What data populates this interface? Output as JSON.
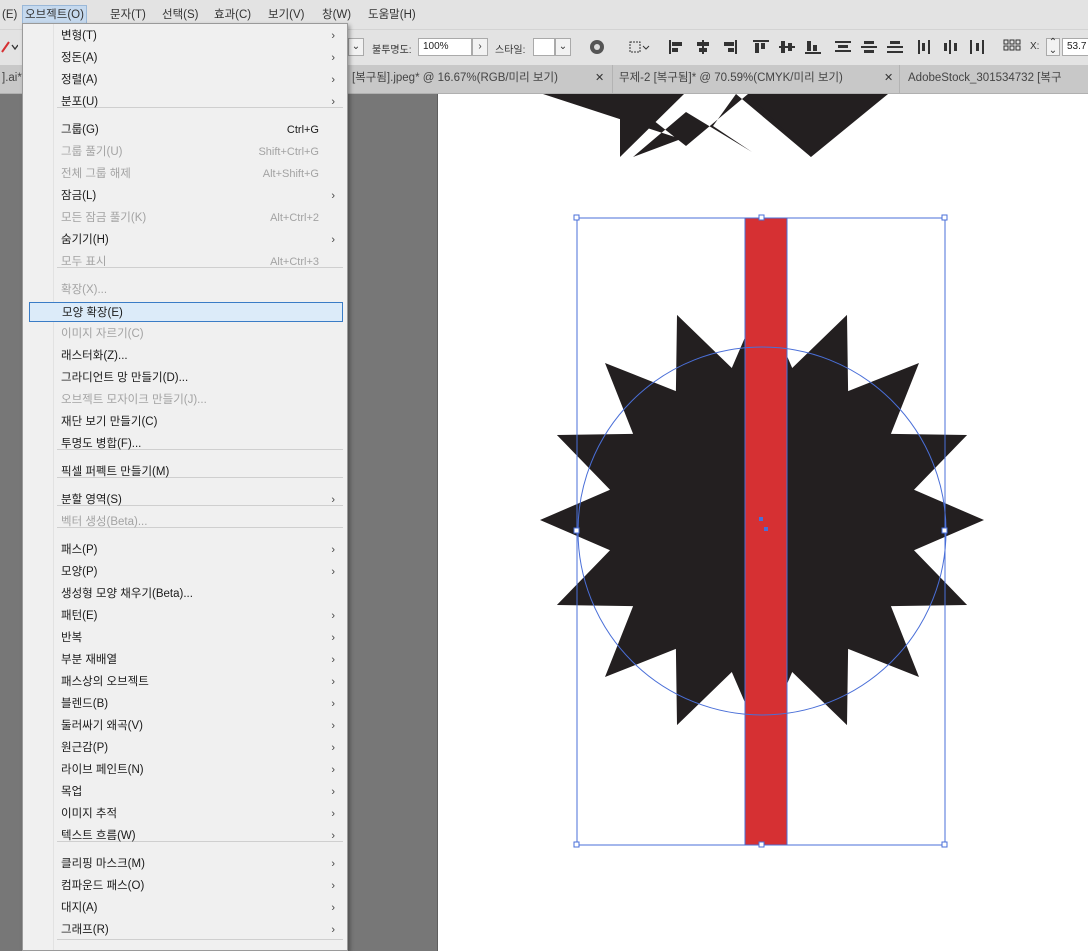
{
  "menubar": {
    "items": [
      "(E)",
      "오브젝트(O)",
      "문자(T)",
      "선택(S)",
      "효과(C)",
      "보기(V)",
      "창(W)",
      "도움말(H)"
    ]
  },
  "controlbar": {
    "opacity_label": "불투명도:",
    "opacity_value": "100%",
    "style_label": "스타일:",
    "x_label": "X:",
    "x_value": "53.7"
  },
  "tabs": [
    {
      "label": "].ai*"
    },
    {
      "label": "[복구됨].jpeg* @ 16.67%(RGB/미리 보기)"
    },
    {
      "label": "무제-2 [복구됨]* @ 70.59%(CMYK/미리 보기)"
    },
    {
      "label": "AdobeStock_301534732 [복구"
    }
  ],
  "object_menu": {
    "items": [
      {
        "label": "변형(T)",
        "submenu": true
      },
      {
        "label": "정돈(A)",
        "submenu": true
      },
      {
        "label": "정렬(A)",
        "submenu": true
      },
      {
        "label": "분포(U)",
        "submenu": true
      },
      {
        "label": "그룹(G)",
        "shortcut": "Ctrl+G"
      },
      {
        "label": "그룹 풀기(U)",
        "shortcut": "Shift+Ctrl+G",
        "disabled": true
      },
      {
        "label": "전체 그룹 해제",
        "shortcut": "Alt+Shift+G",
        "disabled": true
      },
      {
        "label": "잠금(L)",
        "submenu": true
      },
      {
        "label": "모든 잠금 풀기(K)",
        "shortcut": "Alt+Ctrl+2",
        "disabled": true
      },
      {
        "label": "숨기기(H)",
        "submenu": true
      },
      {
        "label": "모두 표시",
        "shortcut": "Alt+Ctrl+3",
        "disabled": true
      },
      {
        "label": "확장(X)...",
        "disabled": true
      },
      {
        "label": "모양 확장(E)",
        "highlighted": true
      },
      {
        "label": "이미지 자르기(C)",
        "disabled": true
      },
      {
        "label": "래스터화(Z)..."
      },
      {
        "label": "그라디언트 망 만들기(D)..."
      },
      {
        "label": "오브젝트 모자이크 만들기(J)...",
        "disabled": true
      },
      {
        "label": "재단 보기 만들기(C)"
      },
      {
        "label": "투명도 병합(F)..."
      },
      {
        "label": "픽셀 퍼펙트 만들기(M)"
      },
      {
        "label": "분할 영역(S)",
        "submenu": true
      },
      {
        "label": "벡터 생성(Beta)...",
        "disabled": true
      },
      {
        "label": "패스(P)",
        "submenu": true
      },
      {
        "label": "모양(P)",
        "submenu": true
      },
      {
        "label": "생성형 모양 채우기(Beta)..."
      },
      {
        "label": "패턴(E)",
        "submenu": true
      },
      {
        "label": "반복",
        "submenu": true
      },
      {
        "label": "부분 재배열",
        "submenu": true
      },
      {
        "label": "패스상의 오브젝트",
        "submenu": true
      },
      {
        "label": "블렌드(B)",
        "submenu": true
      },
      {
        "label": "둘러싸기 왜곡(V)",
        "submenu": true
      },
      {
        "label": "원근감(P)",
        "submenu": true
      },
      {
        "label": "라이브 페인트(N)",
        "submenu": true
      },
      {
        "label": "목업",
        "submenu": true
      },
      {
        "label": "이미지 추적",
        "submenu": true
      },
      {
        "label": "텍스트 흐름(W)",
        "submenu": true
      },
      {
        "label": "클리핑 마스크(M)",
        "submenu": true
      },
      {
        "label": "컴파운드 패스(O)",
        "submenu": true
      },
      {
        "label": "대지(A)",
        "submenu": true
      },
      {
        "label": "그래프(R)",
        "submenu": true
      }
    ]
  },
  "colors": {
    "menu_highlight_bg": "#dcebf9",
    "menu_highlight_border": "#3a7cc6",
    "selection_blue": "#4a6fd8",
    "rect_red": "#d63033",
    "shape_black": "#231f20"
  }
}
